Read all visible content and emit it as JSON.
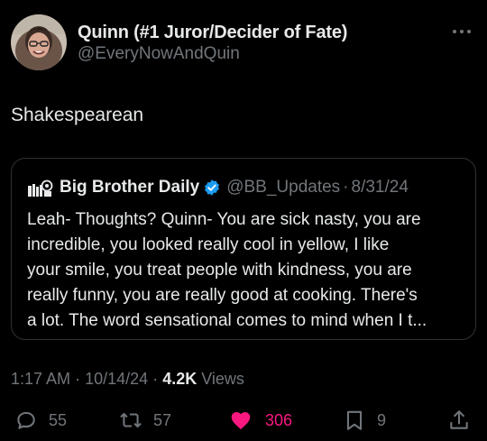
{
  "author": {
    "display_name": "Quinn (#1 Juror/Decider of Fate)",
    "handle": "@EveryNowAndQuin"
  },
  "tweet": {
    "text": "Shakespearean"
  },
  "quote": {
    "display_name": "Big Brother Daily",
    "handle": "@BB_Updates",
    "separator": "·",
    "date": "8/31/24",
    "lines": [
      "Leah- Thoughts? Quinn- You are sick nasty, you are",
      "incredible, you looked really cool in yellow, I like",
      "your smile, you treat people with kindness, you are",
      "really funny, you are really good at cooking. There's",
      "a lot. The word sensational comes to mind when I t..."
    ]
  },
  "meta": {
    "time": "1:17 AM",
    "separator": "·",
    "date": "10/14/24",
    "views_count": "4.2K",
    "views_label": "Views"
  },
  "actions": {
    "replies": "55",
    "retweets": "57",
    "likes": "306",
    "bookmarks": "9"
  },
  "colors": {
    "background": "#000000",
    "text": "#e7e9ea",
    "muted": "#71767b",
    "like": "#f91880",
    "verified": "#1d9bf0",
    "border": "#2f3336"
  },
  "icons": [
    "more-icon",
    "verified-icon",
    "reply-icon",
    "retweet-icon",
    "heart-icon",
    "bookmark-icon",
    "share-icon"
  ]
}
